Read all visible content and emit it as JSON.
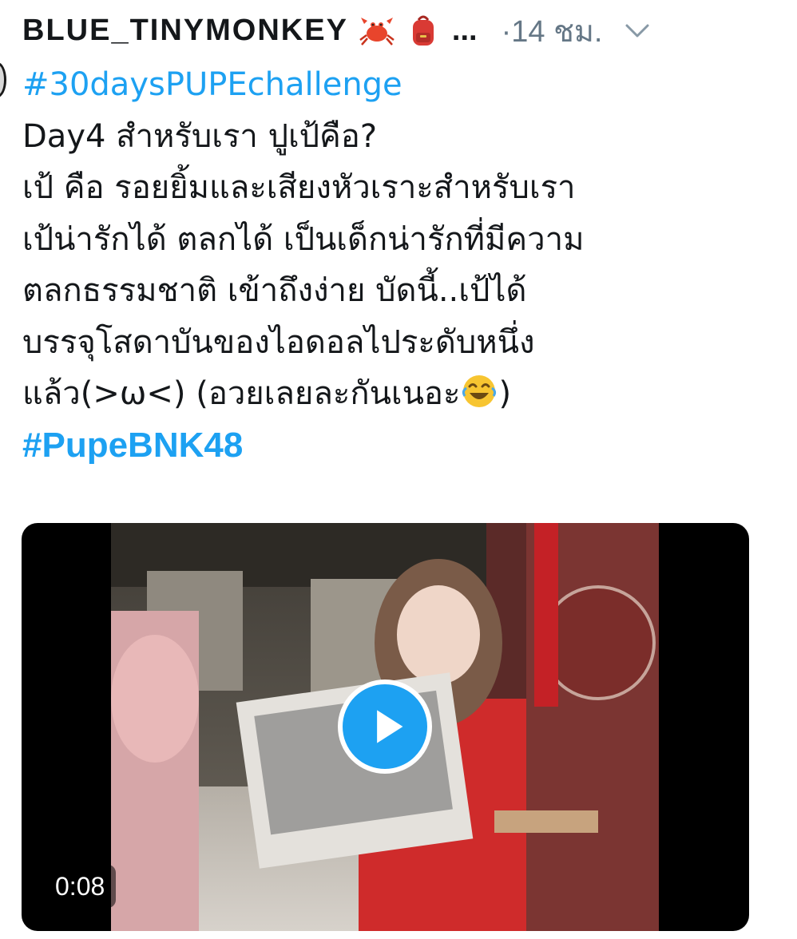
{
  "header": {
    "username": "BLUE_TINYMONKEY",
    "emojis": [
      "crab-emoji",
      "backpack-emoji"
    ],
    "ellipsis": "...",
    "time": "·14 ชม."
  },
  "tweet": {
    "hashtag_top": "#30daysPUPEchallenge",
    "lines": [
      "Day4 สำหรับเรา ปูเป้คือ?",
      "เป้ คือ รอยยิ้มและเสียงหัวเราะสำหรับเรา",
      "เป้น่ารักได้ ตลกได้ เป็นเด็กน่ารักที่มีความ",
      "ตลกธรรมชาติ เข้าถึงง่าย บัดนี้..เป้ได้",
      "บรรจุโสดาบันของไอดอลไประดับหนึ่ง"
    ],
    "last_line_start": "แล้ว(>ω<) (อวยเลยละกันเนอะ",
    "last_line_end": ")",
    "hashtag_bottom": "#PupeBNK48"
  },
  "video": {
    "duration": "0:08"
  },
  "colors": {
    "link": "#1da1f2",
    "text": "#14171a",
    "muted": "#657786"
  }
}
